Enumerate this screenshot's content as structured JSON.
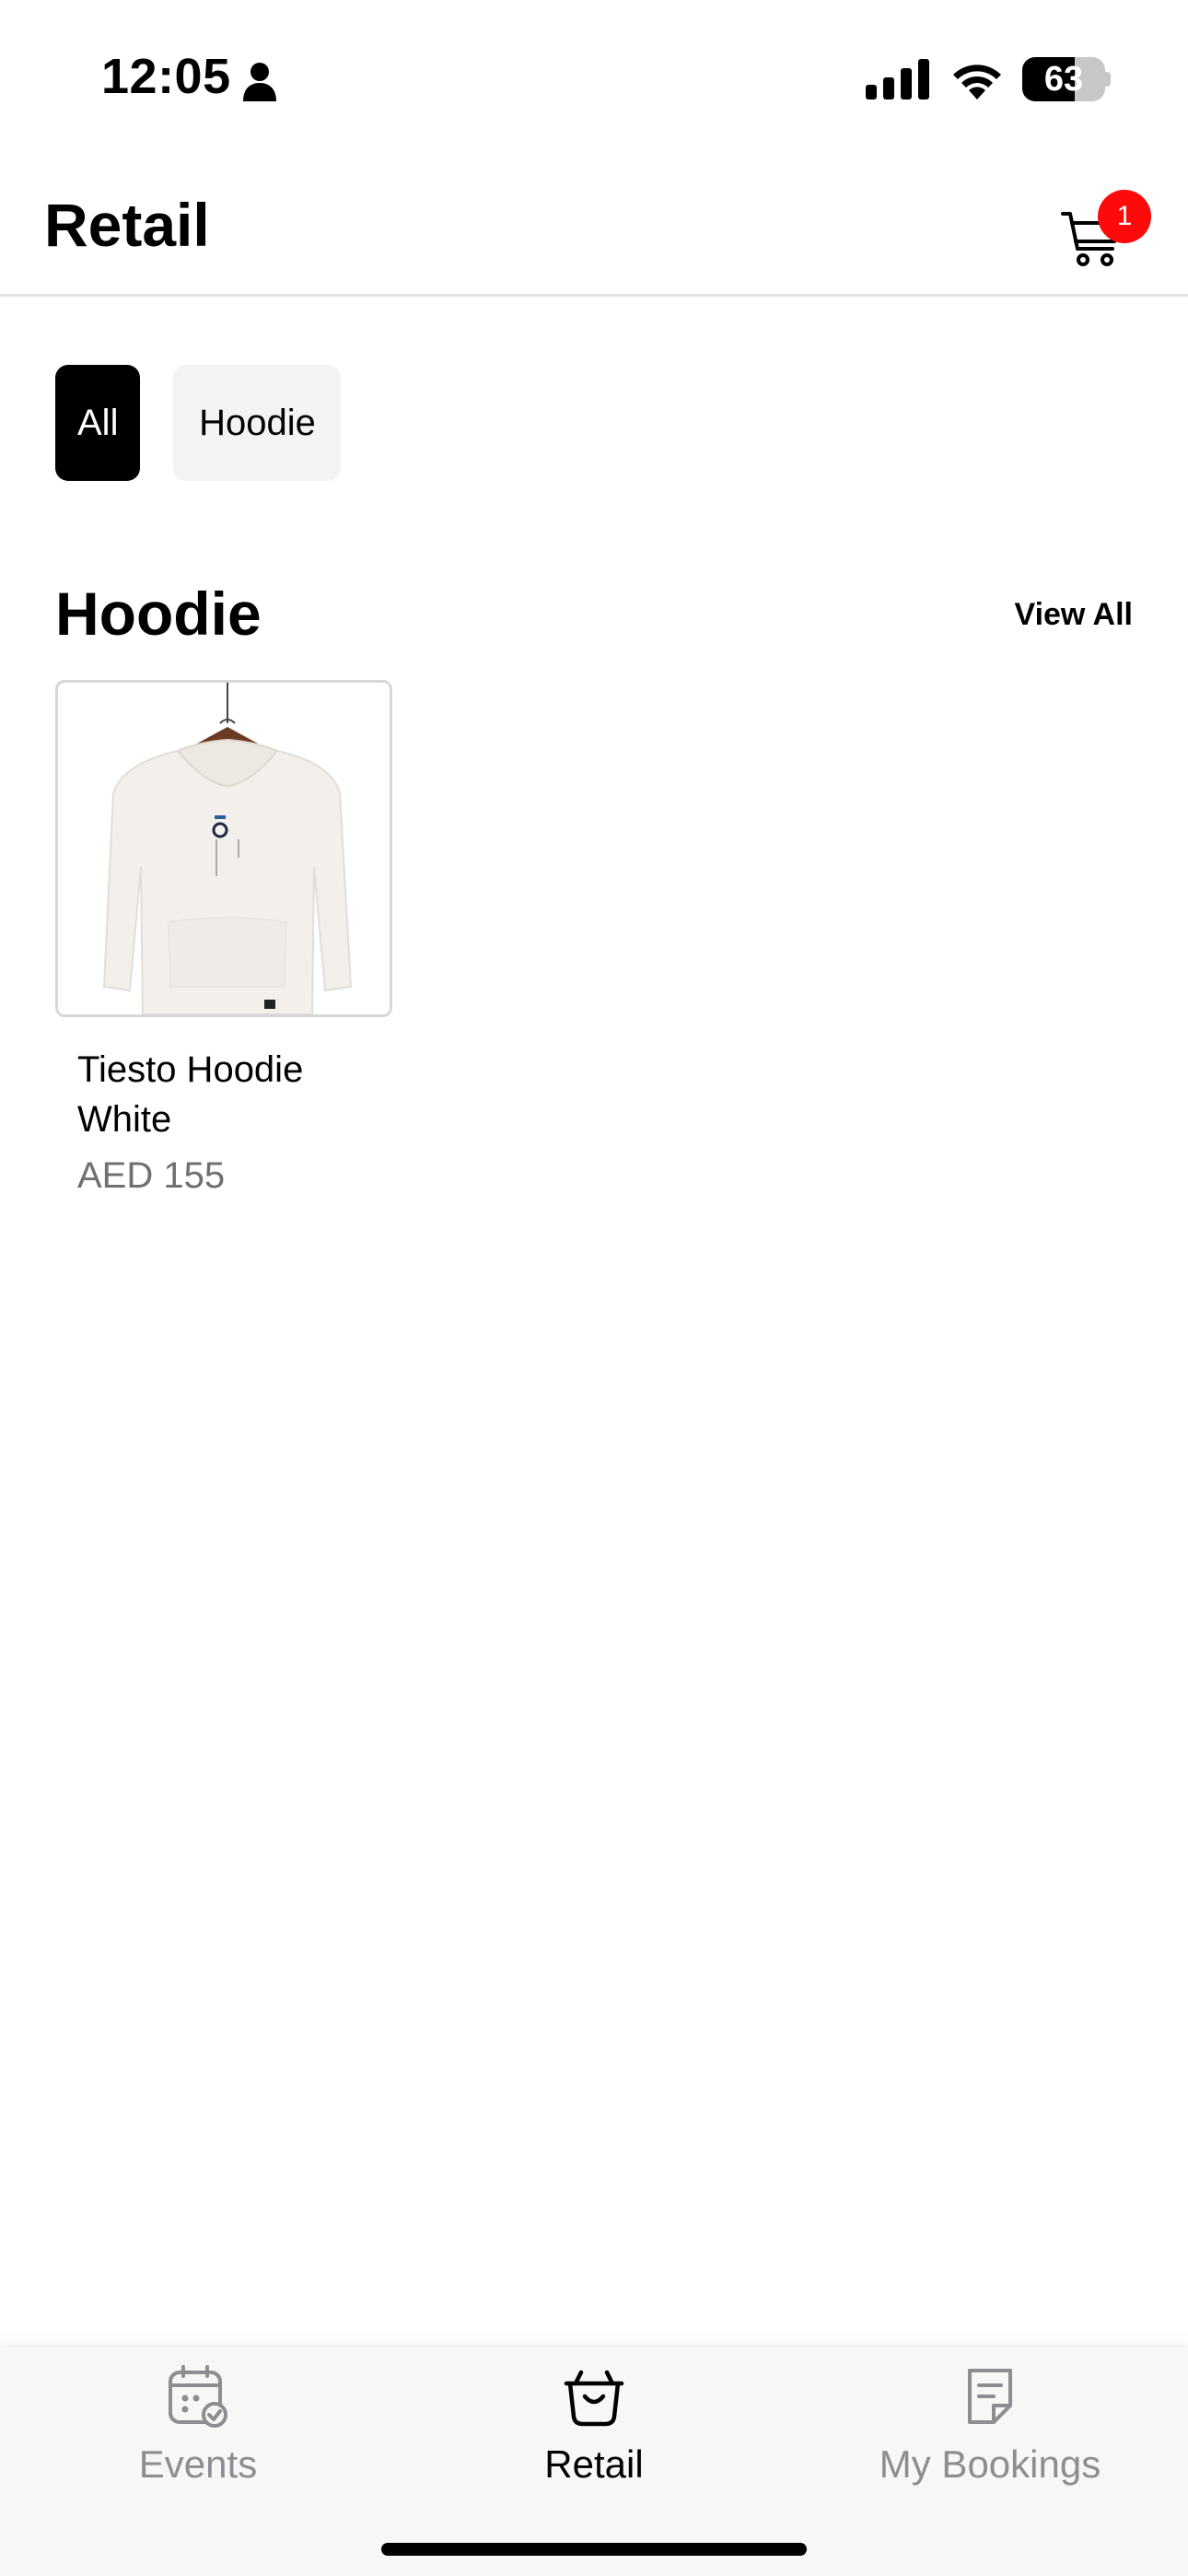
{
  "status_bar": {
    "time": "12:05",
    "battery_level": "63",
    "battery_fraction": 0.63
  },
  "header": {
    "title": "Retail",
    "cart_badge_count": "1",
    "cart_icon": "cart-icon"
  },
  "filters": {
    "chips": [
      {
        "label": "All",
        "selected": true
      },
      {
        "label": "Hoodie",
        "selected": false
      }
    ]
  },
  "section": {
    "title": "Hoodie",
    "view_all_label": "View All"
  },
  "products": [
    {
      "name": "Tiesto Hoodie White",
      "price": "AED 155",
      "image_icon": "hoodie-image"
    }
  ],
  "bottom_nav": {
    "items": [
      {
        "label": "Events",
        "icon": "calendar-check-icon",
        "active": false
      },
      {
        "label": "Retail",
        "icon": "shopping-basket-icon",
        "active": true
      },
      {
        "label": "My Bookings",
        "icon": "document-icon",
        "active": false
      }
    ]
  },
  "colors": {
    "badge": "#ff0a0a",
    "chip_active_bg": "#000000",
    "chip_inactive_bg": "#f3f3f3",
    "nav_inactive": "#8d8d92",
    "price": "#707070"
  }
}
